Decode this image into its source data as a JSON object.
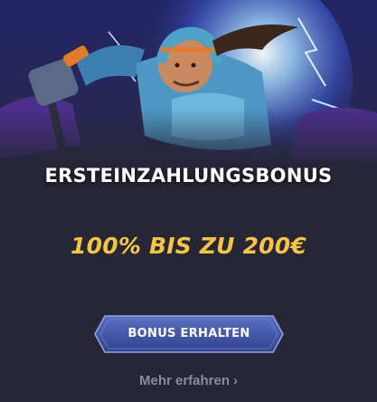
{
  "promo": {
    "title": "ERSTEINZAHLUNGSBONUS",
    "amount": "100% BIS ZU 200€",
    "cta_label": "BONUS ERHALTEN",
    "more_label": "Mehr erfahren",
    "more_icon": "chevron-right-icon",
    "hero_image": "hockey-player-illustration"
  },
  "colors": {
    "background": "#262636",
    "amount": "#f5c542",
    "button": "#3a4f9e",
    "button_border": "#8fa6e8",
    "link": "#8b8b9a"
  }
}
